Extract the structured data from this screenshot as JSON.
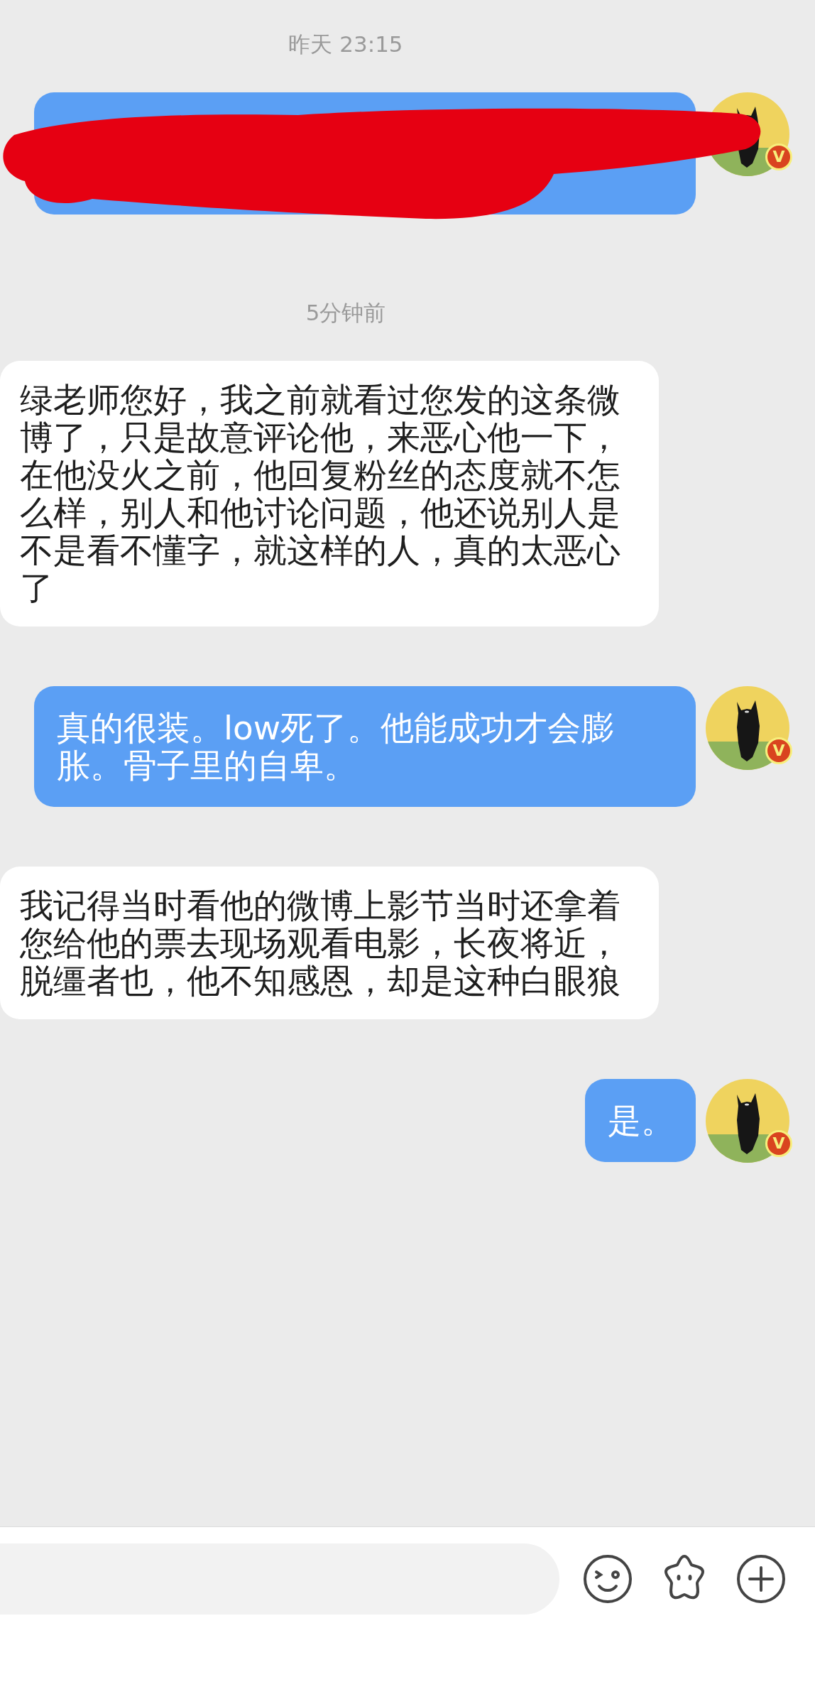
{
  "messages": [
    {
      "kind": "time",
      "text": "昨天 23:15"
    },
    {
      "kind": "sent",
      "redacted": true,
      "badge": "V"
    },
    {
      "kind": "time",
      "text": "5分钟前"
    },
    {
      "kind": "received",
      "text": "绿老师您好，我之前就看过您发的这条微博了，只是故意评论他，来恶心他一下，在他没火之前，他回复粉丝的态度就不怎么样，别人和他讨论问题，他还说别人是不是看不懂字，就这样的人，真的太恶心了"
    },
    {
      "kind": "sent",
      "redacted": false,
      "text": "真的很装。low死了。他能成功才会膨胀。骨子里的自卑。",
      "badge": "V"
    },
    {
      "kind": "received",
      "text": "我记得当时看他的微博上影节当时还拿着您给他的票去现场观看电影，长夜将近，脱缰者也，他不知感恩，却是这种白眼狼"
    },
    {
      "kind": "sent",
      "redacted": false,
      "text": "是。",
      "badge": "V"
    }
  ]
}
